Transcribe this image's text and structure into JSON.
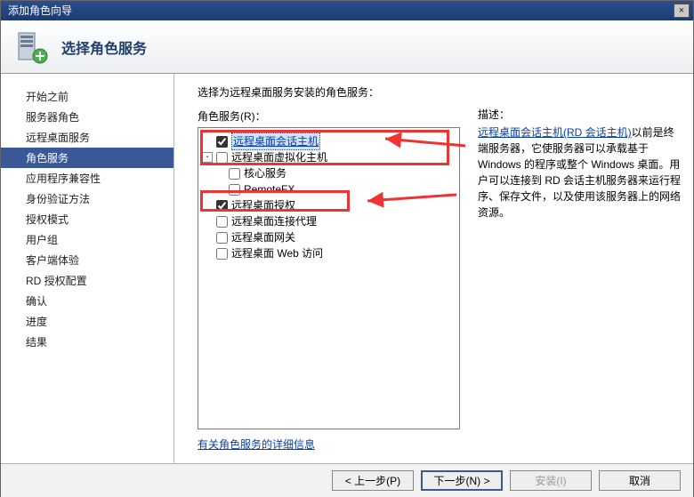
{
  "window": {
    "title": "添加角色向导",
    "close": "×"
  },
  "header": {
    "heading": "选择角色服务"
  },
  "sidebar": {
    "items": [
      {
        "label": "开始之前"
      },
      {
        "label": "服务器角色"
      },
      {
        "label": "远程桌面服务"
      },
      {
        "label": "角色服务",
        "selected": true
      },
      {
        "label": "应用程序兼容性"
      },
      {
        "label": "身份验证方法"
      },
      {
        "label": "授权模式"
      },
      {
        "label": "用户组"
      },
      {
        "label": "客户端体验"
      },
      {
        "label": "RD 授权配置"
      },
      {
        "label": "确认"
      },
      {
        "label": "进度"
      },
      {
        "label": "结果"
      }
    ]
  },
  "main": {
    "instruction": "选择为远程桌面服务安装的角色服务：",
    "services_label": "角色服务(R)：",
    "desc_label": "描述：",
    "learn_more": "有关角色服务的详细信息",
    "desc_link": "远程桌面会话主机(RD 会话主机)",
    "desc_text": "以前是终端服务器，它使服务器可以承载基于 Windows 的程序或整个 Windows 桌面。用户可以连接到 RD 会话主机服务器来运行程序、保存文件，以及使用该服务器上的网络资源。",
    "tree": [
      {
        "indent": 0,
        "exp": null,
        "checked": true,
        "label": "远程桌面会话主机",
        "link": true,
        "highlight": true
      },
      {
        "indent": 0,
        "exp": "-",
        "checked": false,
        "label": "远程桌面虚拟化主机"
      },
      {
        "indent": 1,
        "exp": null,
        "checked": false,
        "label": "核心服务"
      },
      {
        "indent": 1,
        "exp": null,
        "checked": false,
        "label": "RemoteFX"
      },
      {
        "indent": 0,
        "exp": null,
        "checked": true,
        "label": "远程桌面授权"
      },
      {
        "indent": 0,
        "exp": null,
        "checked": false,
        "label": "远程桌面连接代理"
      },
      {
        "indent": 0,
        "exp": null,
        "checked": false,
        "label": "远程桌面网关"
      },
      {
        "indent": 0,
        "exp": null,
        "checked": false,
        "label": "远程桌面 Web 访问"
      }
    ]
  },
  "footer": {
    "prev": "< 上一步(P)",
    "next": "下一步(N) >",
    "install": "安装(I)",
    "cancel": "取消"
  }
}
